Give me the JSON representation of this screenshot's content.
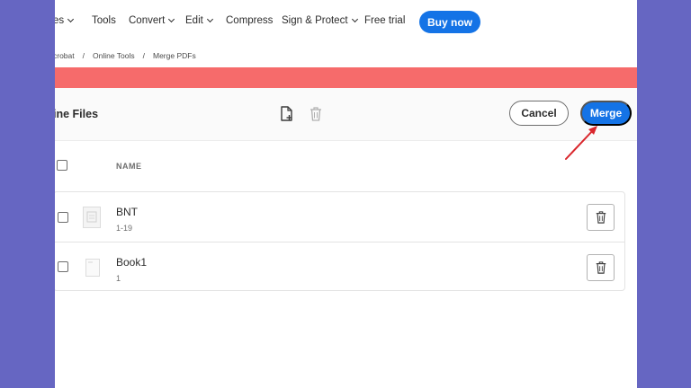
{
  "nav": {
    "items": [
      {
        "label": "es",
        "has_dropdown": true
      },
      {
        "label": "Tools",
        "has_dropdown": false
      },
      {
        "label": "Convert",
        "has_dropdown": true
      },
      {
        "label": "Edit",
        "has_dropdown": true
      },
      {
        "label": "Compress",
        "has_dropdown": false
      },
      {
        "label": "Sign & Protect",
        "has_dropdown": true
      },
      {
        "label": "Free trial",
        "has_dropdown": false
      }
    ],
    "buy_label": "Buy now"
  },
  "breadcrumb": [
    "crobat",
    "Online Tools",
    "Merge PDFs"
  ],
  "breadcrumb_separator": "/",
  "toolbar": {
    "title": "ine Files",
    "cancel_label": "Cancel",
    "merge_label": "Merge"
  },
  "table": {
    "name_header": "NAME",
    "files": [
      {
        "name": "BNT",
        "pages": "1-19"
      },
      {
        "name": "Book1",
        "pages": "1"
      }
    ]
  },
  "colors": {
    "accent": "#1473e6",
    "banner": "#f66b6b",
    "frame": "#6666c2",
    "annotation_arrow": "#d9262c"
  }
}
